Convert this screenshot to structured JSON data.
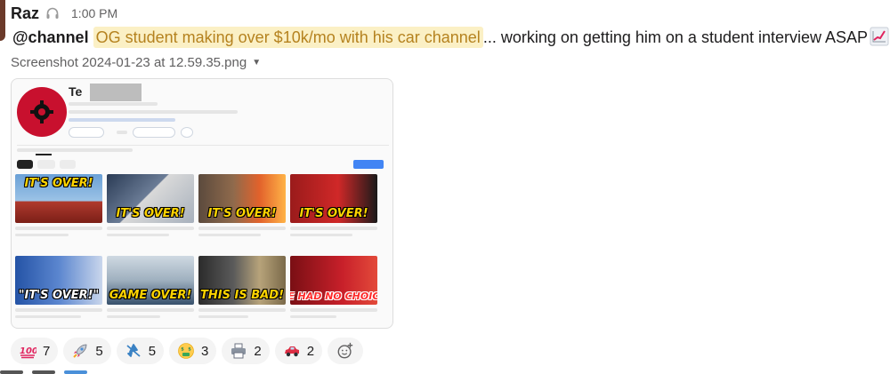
{
  "message": {
    "author": "Raz",
    "timestamp": "1:00 PM",
    "mention": "@channel",
    "highlight_text": "OG student making over $10k/mo with his car channel",
    "rest_text": "... working on getting him on a student interview ASAP",
    "status_icon": "headphones-icon",
    "trailing_emoji": "chart-increasing-icon"
  },
  "attachment": {
    "file_name": "Screenshot 2024-01-23 at 12.59.35.png",
    "channel_name_prefix": "Te",
    "thumbnails": [
      {
        "title": "IT'S OVER!",
        "icon": "pickup-truck-thumbnail"
      },
      {
        "title": "IT'S OVER!",
        "icon": "laser-weapon-thumbnail"
      },
      {
        "title": "IT'S OVER!",
        "icon": "explosion-thumbnail"
      },
      {
        "title": "IT'S OVER!",
        "icon": "gm-ceo-thumbnail"
      },
      {
        "title": "\"IT'S OVER!\"",
        "icon": "ford-ceo-thumbnail"
      },
      {
        "title": "GAME OVER!",
        "icon": "warship-thumbnail"
      },
      {
        "title": "THIS IS BAD!",
        "icon": "tank-thumbnail"
      },
      {
        "title": "WE HAD NO CHOICE!",
        "icon": "gm-ceo-red-thumbnail"
      }
    ]
  },
  "reactions": [
    {
      "emoji": "hundred-points-icon",
      "glyph": "💯",
      "count": "7"
    },
    {
      "emoji": "rocket-icon",
      "glyph": "🚀",
      "count": "5"
    },
    {
      "emoji": "airplane-icon",
      "glyph": "✈",
      "count": "5"
    },
    {
      "emoji": "money-mouth-face-icon",
      "glyph": "🤑",
      "count": "3"
    },
    {
      "emoji": "printer-icon",
      "glyph": "🖨",
      "count": "2"
    },
    {
      "emoji": "red-car-icon",
      "glyph": "🚗",
      "count": "2"
    }
  ],
  "colors": {
    "highlight_bg": "#fbf0c5",
    "highlight_text": "#b5821f",
    "reaction_bg": "#f4f4f4",
    "youtube_red": "#c8102e",
    "youtube_blue": "#4285f4"
  }
}
